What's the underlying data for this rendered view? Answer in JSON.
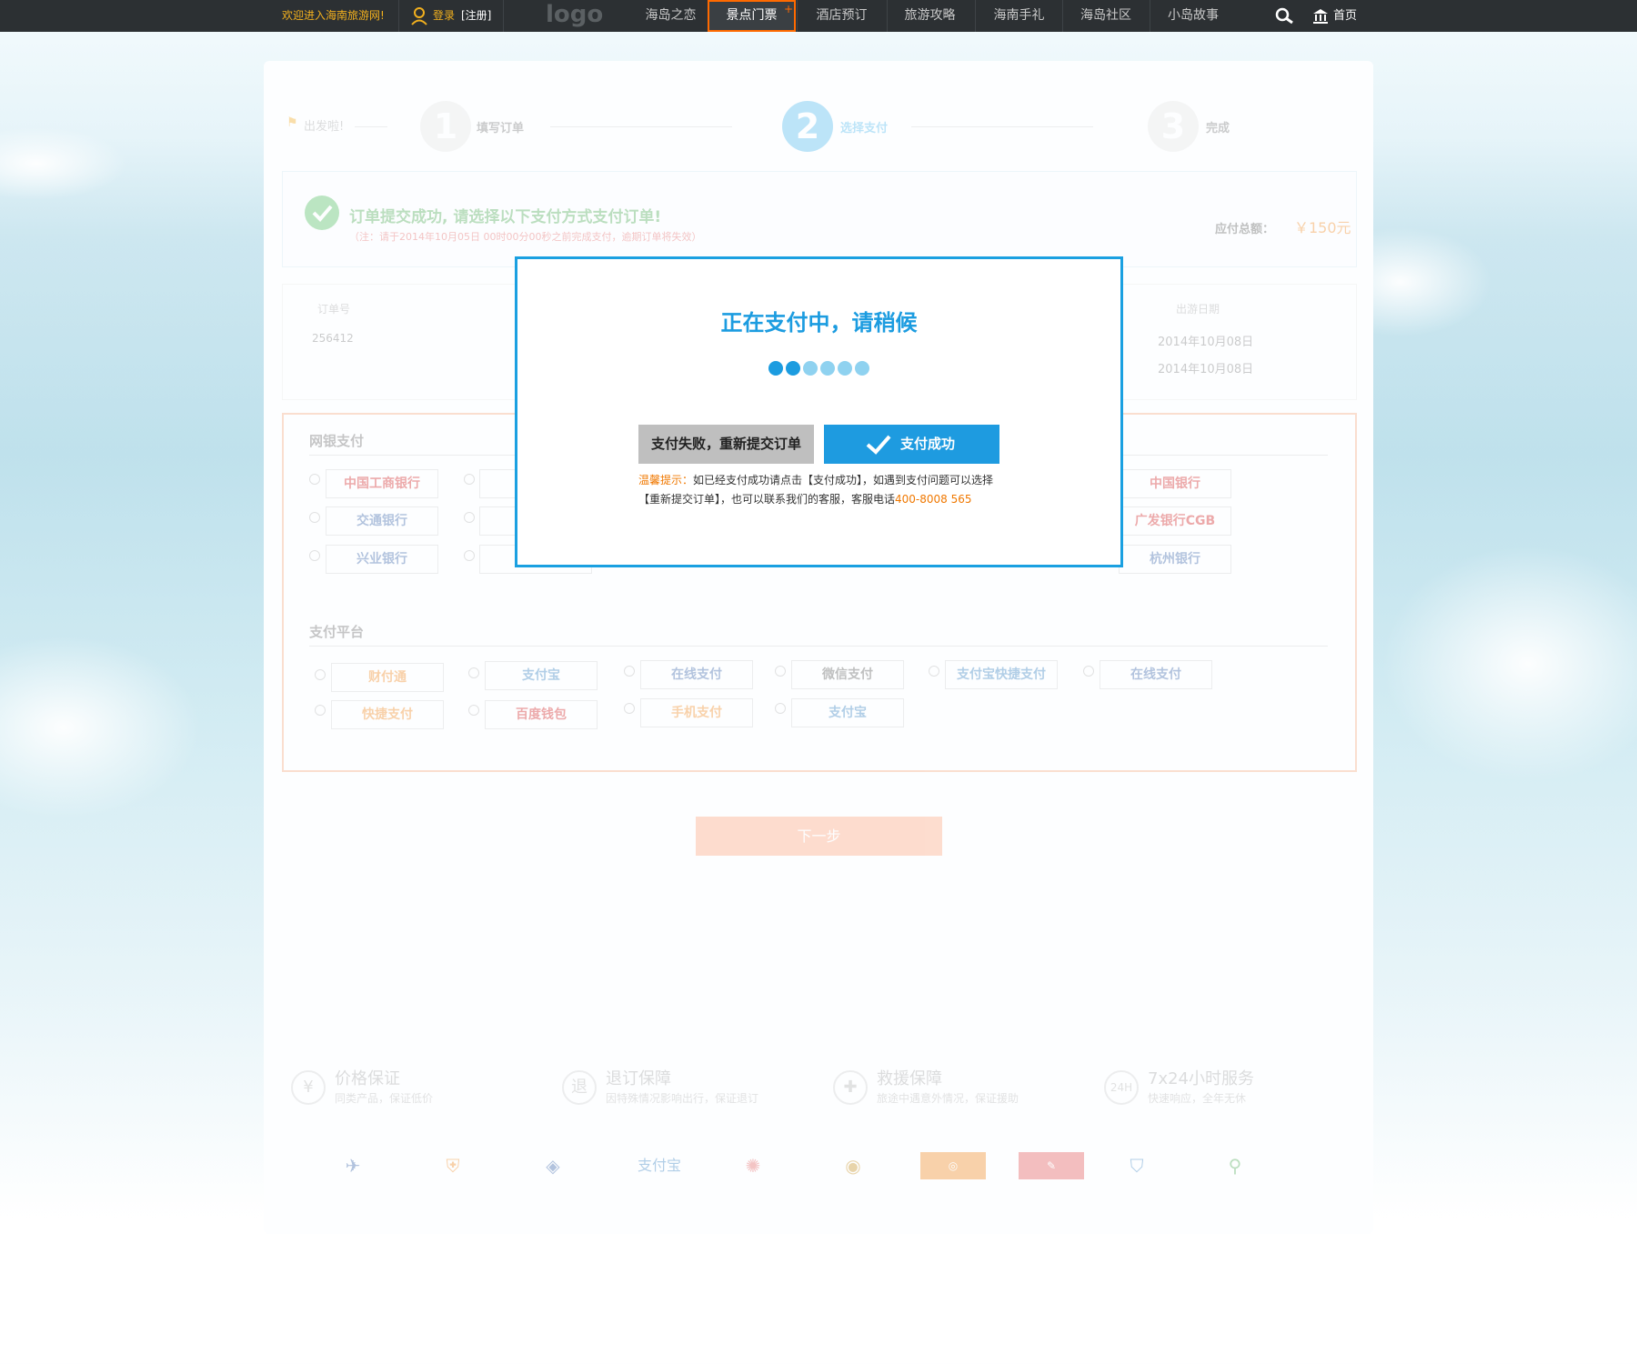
{
  "nav": {
    "welcome": "欢迎进入海南旅游网!",
    "login": "登录",
    "register": "[注册]",
    "logo": "logo",
    "items": [
      "海岛之恋",
      "景点门票",
      "酒店预订",
      "旅游攻略",
      "海南手礼",
      "海岛社区",
      "小岛故事"
    ],
    "active_plus": "+",
    "home": "首页"
  },
  "steps": {
    "start": "出发啦!",
    "s1": "1",
    "s1_label": "填写订单",
    "s2": "2",
    "s2_label": "选择支付",
    "s3": "3",
    "s3_label": "完成"
  },
  "notice": {
    "title": "订单提交成功, 请选择以下支付方式支付订单!",
    "note": "（注：请于2014年10月05日 00时00分00秒之前完成支付，逾期订单将失效）",
    "total_label": "应付总额：",
    "total_value": "￥150元"
  },
  "order": {
    "col_no": "订单号",
    "col_date": "出游日期",
    "no": "256412",
    "date1": "2014年10月08日",
    "date2": "2014年10月08日"
  },
  "payment": {
    "bank_title": "网银支付",
    "platform_title": "支付平台",
    "banks": [
      "中国工商银行",
      "中国银行",
      "交通银行",
      "广发银行CGB",
      "兴业银行",
      "杭州银行"
    ],
    "platforms": [
      "财付通",
      "支付宝",
      "在线支付",
      "微信支付",
      "支付宝快捷支付",
      "在线支付",
      "快捷支付",
      "百度钱包",
      "手机支付",
      "支付宝"
    ]
  },
  "next_button": "下一步",
  "guarantees": [
    {
      "icon": "¥",
      "title": "价格保证",
      "sub": "同类产品，保证低价"
    },
    {
      "icon": "退",
      "title": "退订保障",
      "sub": "因特殊情况影响出行，保证退订"
    },
    {
      "icon": "✚",
      "title": "救援保障",
      "sub": "旅途中遇意外情况，保证援助"
    },
    {
      "icon": "24H",
      "title": "7x24小时服务",
      "sub": "快速响应，全年无休"
    }
  ],
  "modal": {
    "title": "正在支付中，请稍候",
    "fail_button": "支付失败，重新提交订单",
    "ok_button": "支付成功",
    "tip_label": "温馨提示：",
    "tip_text1": "如已经支付成功请点击【支付成功】，如遇到支付问题可以选择",
    "tip_text2": "【重新提交订单】，也可以联系我们的客服，客服电话",
    "phone": "400-8008 565"
  },
  "colors": {
    "accent": "#1e9be0",
    "active_border": "#ff6a00",
    "modal_border": "#1aa0e1",
    "orange": "#f07800"
  }
}
